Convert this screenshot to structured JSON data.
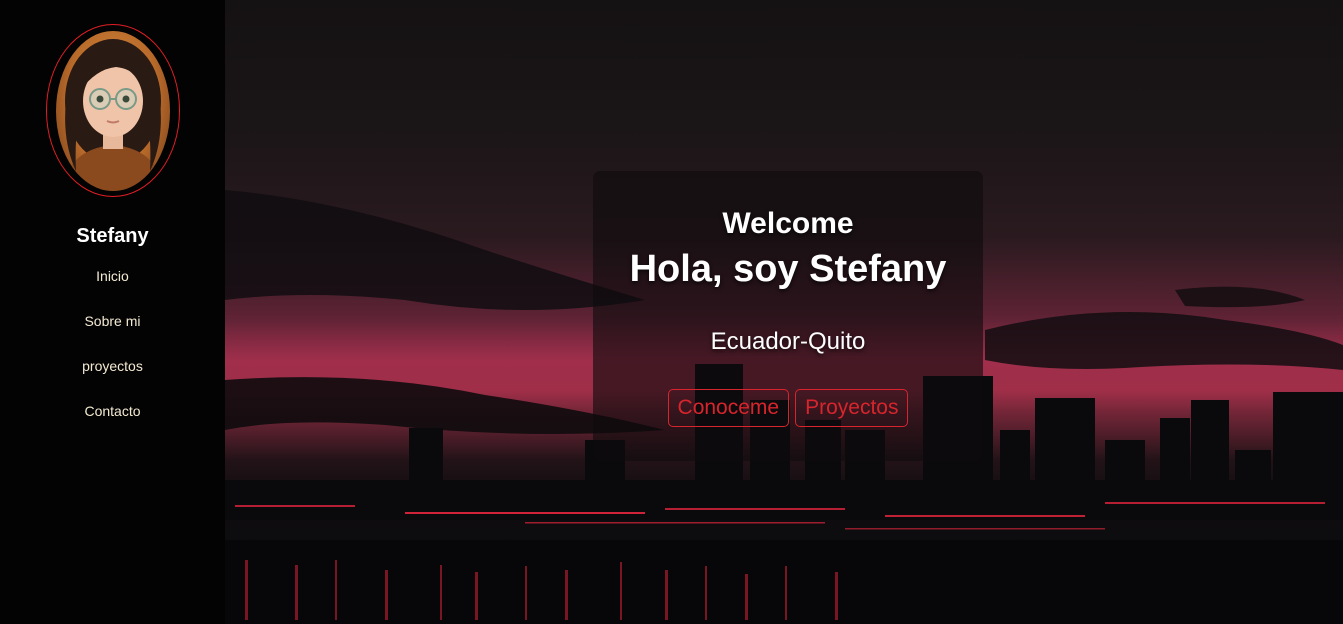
{
  "sidebar": {
    "name": "Stefany",
    "nav": [
      {
        "label": "Inicio"
      },
      {
        "label": "Sobre mi"
      },
      {
        "label": "proyectos"
      },
      {
        "label": "Contacto"
      }
    ],
    "accent_color": "#e01e24"
  },
  "hero": {
    "welcome": "Welcome",
    "headline": "Hola, soy Stefany",
    "location": "Ecuador-Quito",
    "buttons": {
      "about": "Conoceme",
      "projects": "Proyectos"
    },
    "button_color": "#d8242c"
  }
}
